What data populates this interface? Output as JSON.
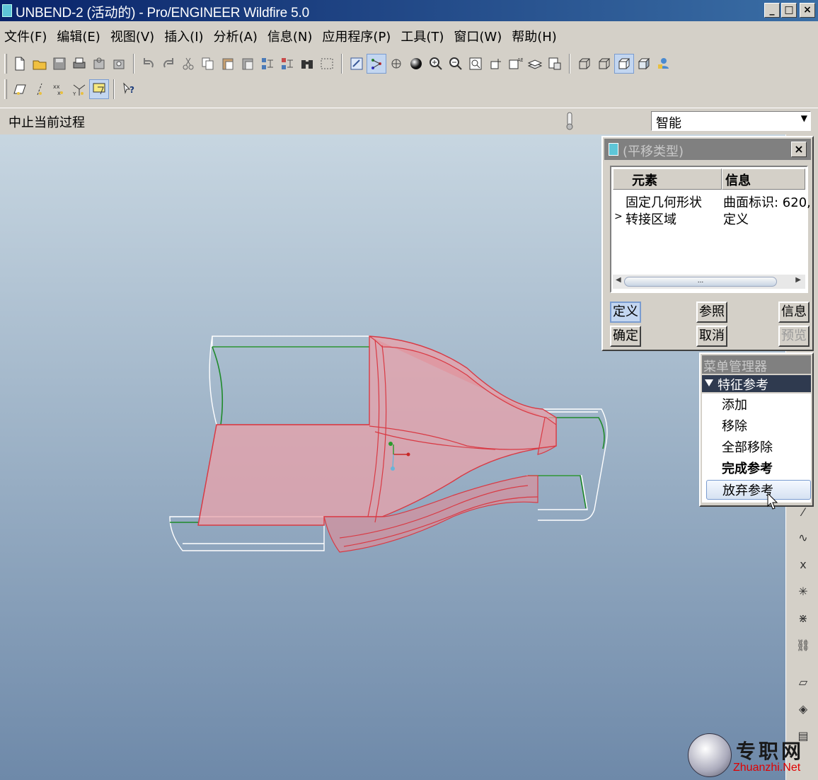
{
  "window": {
    "title": "UNBEND-2 (活动的) - Pro/ENGINEER Wildfire 5.0",
    "buttons": [
      "_",
      "□",
      "×"
    ]
  },
  "menubar": [
    "文件(F)",
    "编辑(E)",
    "视图(V)",
    "插入(I)",
    "分析(A)",
    "信息(N)",
    "应用程序(P)",
    "工具(T)",
    "窗口(W)",
    "帮助(H)"
  ],
  "toolbar_icons": {
    "row1": [
      "new-file-icon",
      "open-folder-icon",
      "save-icon",
      "print-icon",
      "send-icon",
      "send-icon-2",
      "undo-icon",
      "redo-icon",
      "cut-icon",
      "copy-icon",
      "paste-icon",
      "paste-special-icon",
      "regenerate-icon",
      "regen-manager-icon",
      "find-icon",
      "select-box-icon",
      "redraw-icon",
      "spin-center-icon",
      "orient-icon",
      "shading-icon",
      "zoom-in-icon",
      "zoom-out-icon",
      "refit-icon",
      "view-orient-icon",
      "saved-views-icon",
      "layers-icon",
      "view-manager-icon",
      "wireframe-icon",
      "hidden-line-icon",
      "no-hidden-icon",
      "shaded-icon",
      "appearance-icon"
    ],
    "row2": [
      "datum-plane-icon",
      "datum-axis-icon",
      "datum-point-icon",
      "csys-icon",
      "annotation-display-icon",
      "whats-this-icon"
    ]
  },
  "status": {
    "message": "中止当前过程",
    "filter": "智能"
  },
  "dialog": {
    "title": "(平移类型)",
    "columns": [
      "元素",
      "信息"
    ],
    "rows": [
      {
        "element": "固定几何形状",
        "info": "曲面标识: 620,",
        "marker": ""
      },
      {
        "element": "转接区域",
        "info": "定义",
        "marker": ">"
      }
    ],
    "scroll_grip": "...",
    "buttons": {
      "define": "定义",
      "refs": "参照",
      "info": "信息",
      "ok": "确定",
      "cancel": "取消",
      "preview": "预览"
    }
  },
  "menu_manager": {
    "title": "菜单管理器",
    "header": "特征参考",
    "items": [
      "添加",
      "移除",
      "全部移除",
      "完成参考",
      "放弃参考"
    ]
  },
  "watermark": {
    "text": "专职网",
    "url": "Zhuanzhi.Net"
  },
  "colors": {
    "model_fill": "#e9a2aa",
    "model_edge": "#d93a44",
    "wire_edge": "#ffffff",
    "green_edge": "#1f8a2a",
    "viewport_top": "#c7d6e1",
    "viewport_bottom": "#6e89a9"
  }
}
